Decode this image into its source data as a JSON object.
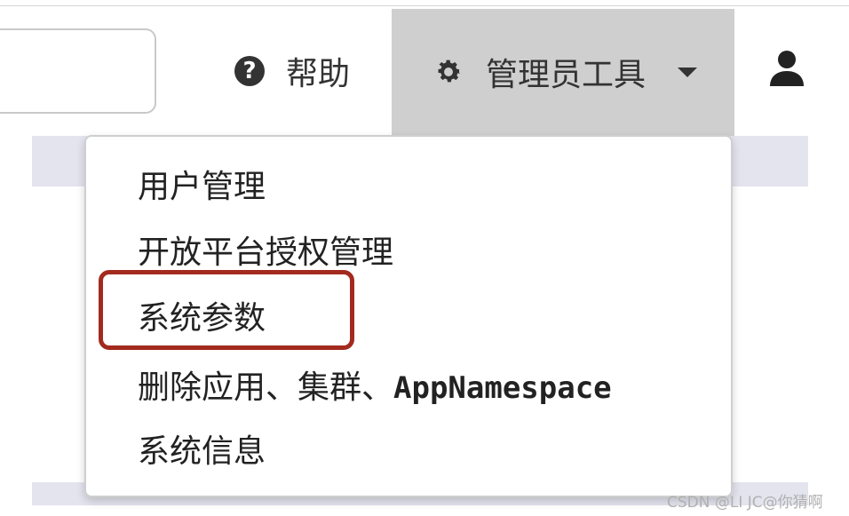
{
  "header": {
    "help_label": "帮助",
    "admin_tools_label": "管理员工具"
  },
  "menu": {
    "items": [
      {
        "label": "用户管理"
      },
      {
        "label": "开放平台授权管理"
      },
      {
        "label": "系统参数"
      },
      {
        "label_cn": "删除应用、集群、",
        "label_code": "AppNamespace"
      },
      {
        "label": "系统信息"
      }
    ]
  },
  "watermark": "CSDN @LI JC@你猜啊",
  "colors": {
    "admin_tab_bg": "#cfcfcf",
    "highlight_border": "#a32a1e",
    "strip_bg": "#e4e4ef"
  },
  "icons": {
    "help": "question-circle-icon",
    "settings": "gear-icon",
    "dropdown": "caret-down-icon",
    "user": "user-icon"
  }
}
